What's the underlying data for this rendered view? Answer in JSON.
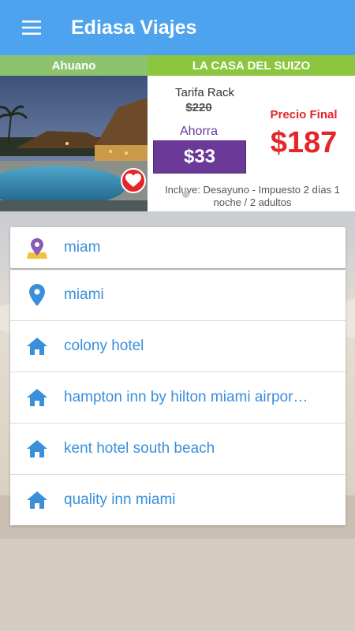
{
  "appbar": {
    "title": "Ediasa Viajes",
    "menu_icon": "hamburger-menu-icon",
    "color": "#4da3ee"
  },
  "promo": {
    "hotel_tab": "Ahuano",
    "hotel_name": "LA CASA DEL SUIZO",
    "rack_label": "Tarifa Rack",
    "rack_price": "$220",
    "save_label": "Ahorra",
    "save_amount": "$33",
    "final_label": "Precio Final",
    "final_price": "$187",
    "includes": "Incluye: Desayuno - Impuesto 2 días 1 noche / 2 adultos",
    "accent_purple": "#6b3a98",
    "accent_red": "#e3262a",
    "accent_green": "#8cc63f"
  },
  "search": {
    "query": "miam",
    "query_icon": "map-pin-icon"
  },
  "suggestions": [
    {
      "label": "miami",
      "icon": "location-pin-icon"
    },
    {
      "label": "colony hotel",
      "icon": "home-icon"
    },
    {
      "label": "hampton inn by hilton miami airpor…",
      "icon": "home-icon"
    },
    {
      "label": "kent hotel south beach",
      "icon": "home-icon"
    },
    {
      "label": "quality inn miami",
      "icon": "home-icon"
    }
  ]
}
